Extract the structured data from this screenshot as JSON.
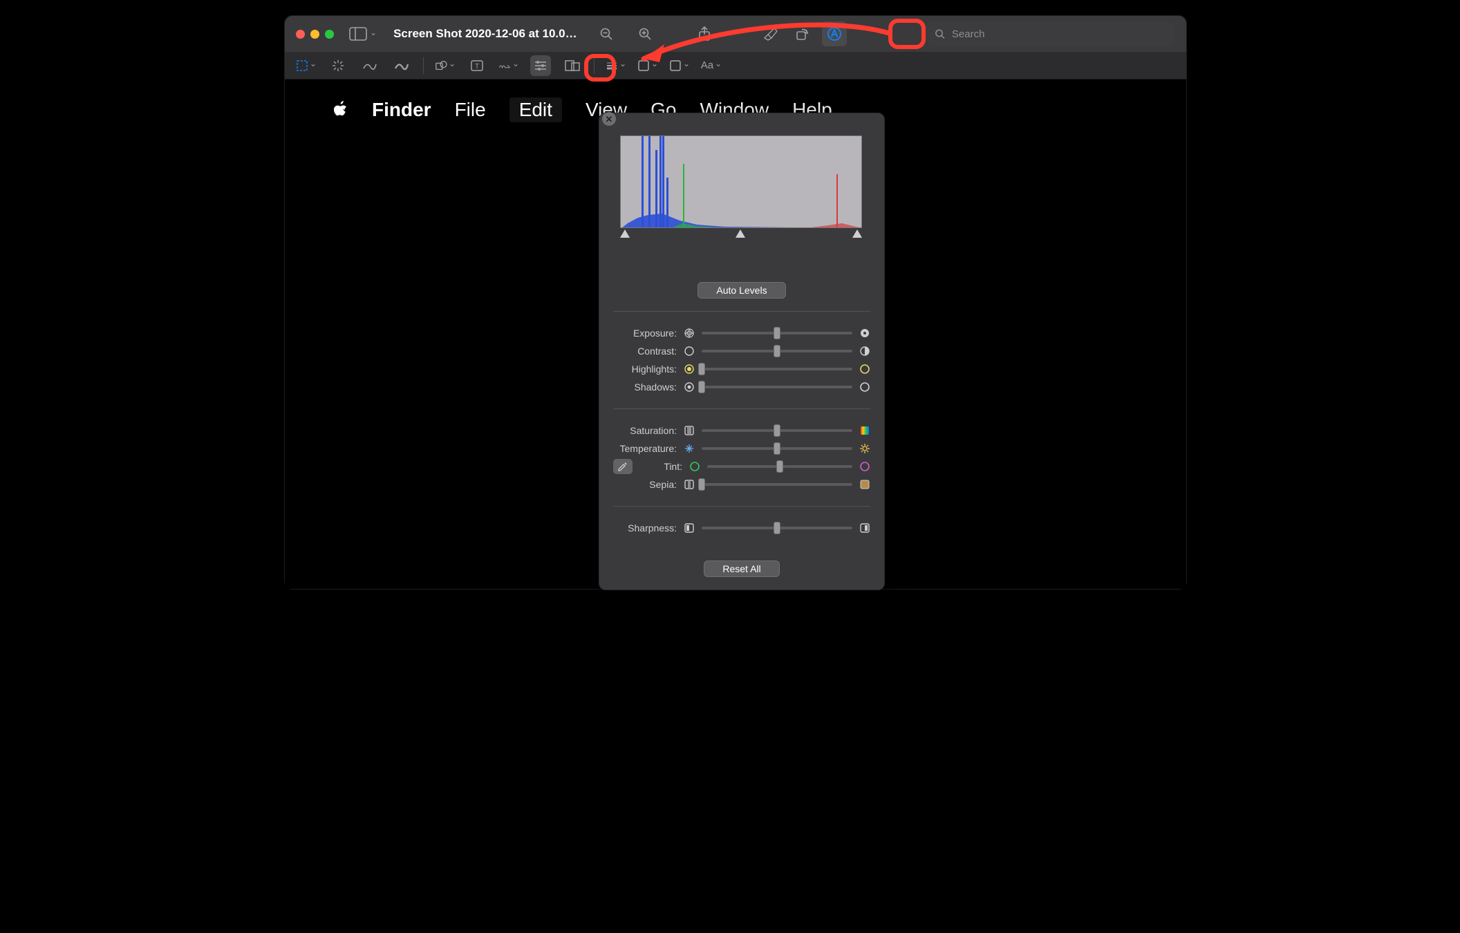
{
  "window": {
    "title": "Screen Shot 2020-12-06 at 10.0…",
    "search_placeholder": "Search"
  },
  "menubar": {
    "app": "Finder",
    "items": [
      "File",
      "Edit",
      "View",
      "Go",
      "Window",
      "Help"
    ]
  },
  "markup_toolbar": {
    "font_label": "Aa"
  },
  "adjust_panel": {
    "auto_levels": "Auto Levels",
    "reset_all": "Reset All",
    "sliders": {
      "exposure": {
        "label": "Exposure:",
        "value": 50
      },
      "contrast": {
        "label": "Contrast:",
        "value": 50
      },
      "highlights": {
        "label": "Highlights:",
        "value": 0
      },
      "shadows": {
        "label": "Shadows:",
        "value": 0
      },
      "saturation": {
        "label": "Saturation:",
        "value": 50
      },
      "temperature": {
        "label": "Temperature:",
        "value": 50
      },
      "tint": {
        "label": "Tint:",
        "value": 50
      },
      "sepia": {
        "label": "Sepia:",
        "value": 0
      },
      "sharpness": {
        "label": "Sharpness:",
        "value": 50
      }
    }
  },
  "colors": {
    "highlight": "#ff3b30"
  }
}
